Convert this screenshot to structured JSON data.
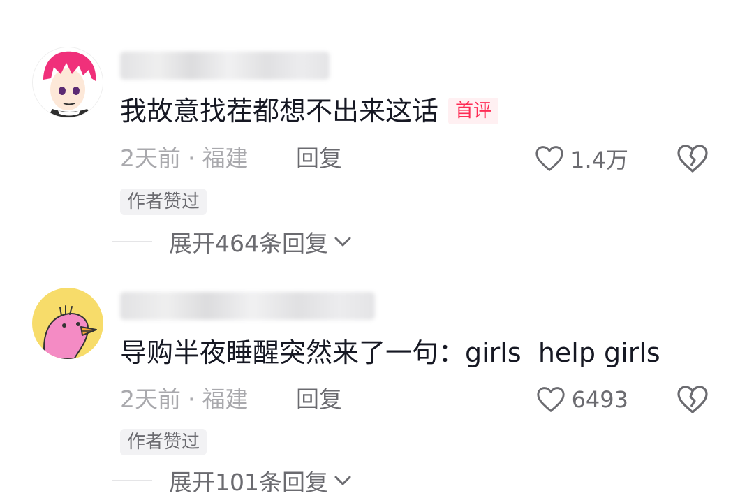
{
  "comments": [
    {
      "text": "我故意找茬都想不出来这话",
      "badge": "首评",
      "time": "2天前",
      "location": "福建",
      "reply_label": "回复",
      "likes": "1.4万",
      "author_liked": "作者赞过",
      "expand_label": "展开464条回复"
    },
    {
      "text": "导购半夜睡醒突然来了一句：girls  help girls",
      "time": "2天前",
      "location": "福建",
      "reply_label": "回复",
      "likes": "6493",
      "author_liked": "作者赞过",
      "expand_label": "展开101条回复"
    }
  ],
  "colors": {
    "accent": "#fe2c55",
    "secondary_text": "#a9a9ad",
    "action_text": "#6b6b70",
    "avatar1_hair": "#f0307a",
    "avatar2_bg": "#f7dc6a",
    "avatar2_bird": "#f48bc4"
  },
  "icons": {
    "like": "heart-outline-icon",
    "dislike": "broken-heart-icon",
    "expand": "chevron-down-icon"
  }
}
